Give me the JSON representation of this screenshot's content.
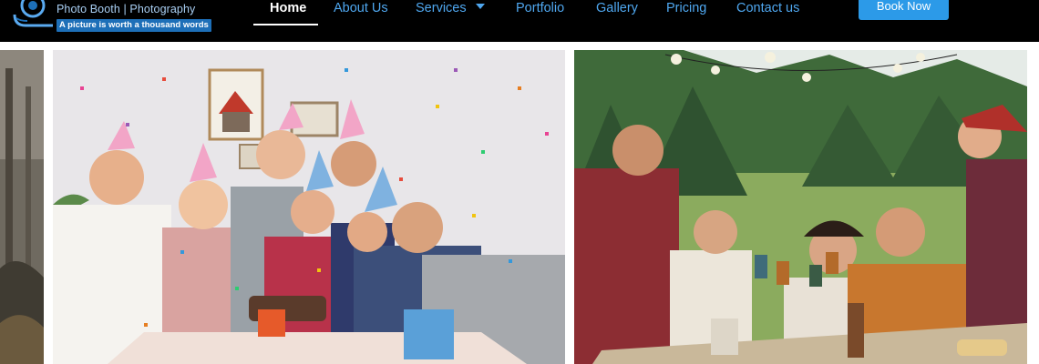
{
  "brand": {
    "title": "Photo Booth | Photography",
    "tagline": "A picture is worth a thousand words"
  },
  "nav": {
    "items": [
      {
        "label": "Home",
        "active": true
      },
      {
        "label": "About Us"
      },
      {
        "label": "Services",
        "has_dropdown": true
      },
      {
        "label": "Portfolio"
      },
      {
        "label": "Gallery"
      },
      {
        "label": "Pricing"
      },
      {
        "label": "Contact us"
      }
    ]
  },
  "cta": {
    "label": "Book Now"
  },
  "gallery": {
    "images": [
      {
        "subject": "forest-edge-photo"
      },
      {
        "subject": "birthday-party-group-with-confetti"
      },
      {
        "subject": "outdoor-dinner-friends-toasting"
      }
    ]
  },
  "colors": {
    "header_bg": "#000000",
    "nav_link": "#4fa7ef",
    "nav_active": "#ffffff",
    "cta_bg": "#2c9ae8",
    "tagline_bg": "#1d6fb8"
  }
}
